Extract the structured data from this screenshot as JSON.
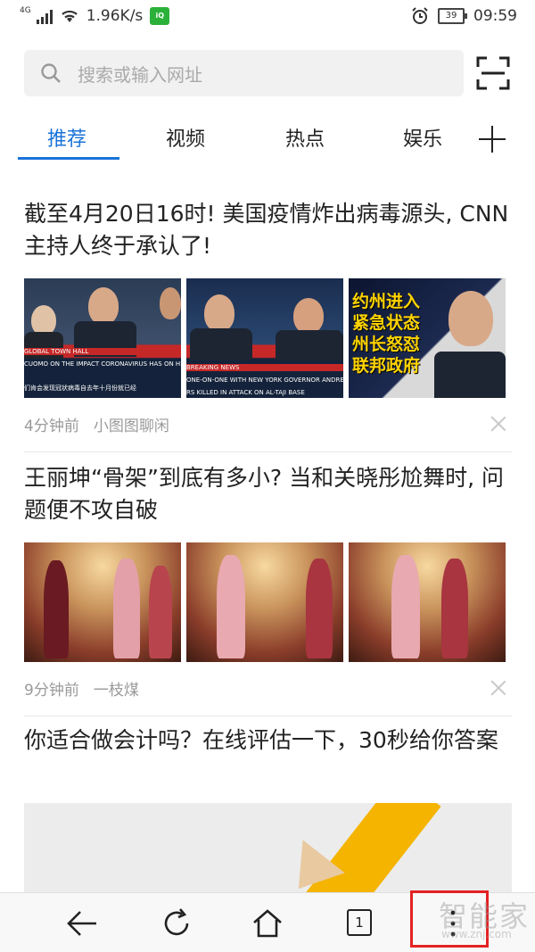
{
  "status_bar": {
    "network": "4G",
    "speed": "1.96K/s",
    "battery": "39",
    "time": "09:59",
    "app_badge": "iQIYI"
  },
  "search": {
    "placeholder": "搜索或输入网址"
  },
  "tabs": [
    {
      "label": "推荐",
      "active": true
    },
    {
      "label": "视频",
      "active": false
    },
    {
      "label": "热点",
      "active": false
    },
    {
      "label": "娱乐",
      "active": false
    }
  ],
  "news": [
    {
      "title": "截至4月20日16时! 美国疫情炸出病毒源头, CNN主持人终于承认了!",
      "time": "4分钟前",
      "source": "小图图聊闲",
      "image_captions": {
        "img1_top": "GLOBAL TOWN HALL",
        "img1_bottom": "CUOMO ON THE IMPACT CORONAVIRUS HAS ON HIS FAMILY",
        "img1_sub": "们肯会发现冠状病毒自去年十月份就已经",
        "img2_top": "BREAKING NEWS",
        "img2_bottom": "ONE-ON-ONE WITH NEW YORK GOVERNOR ANDREW CUOMO",
        "img2_sub": "RS KILLED IN ATTACK ON AL-TAJI BASE",
        "img3_text": "约州进入\n紧急状态\n州长怒怼\n联邦政府"
      }
    },
    {
      "title": "王丽坤“骨架”到底有多小? 当和关晓彤尬舞时, 问题便不攻自破",
      "time": "9分钟前",
      "source": "一枝煤"
    },
    {
      "title": "你适合做会计吗？在线评估一下，30秒给你答案"
    }
  ],
  "bottom_nav": {
    "tab_count": "1"
  },
  "watermark": {
    "text": "智能家",
    "url": "www.znj.com"
  },
  "colors": {
    "accent": "#1a73d8",
    "highlight": "#e32222"
  }
}
